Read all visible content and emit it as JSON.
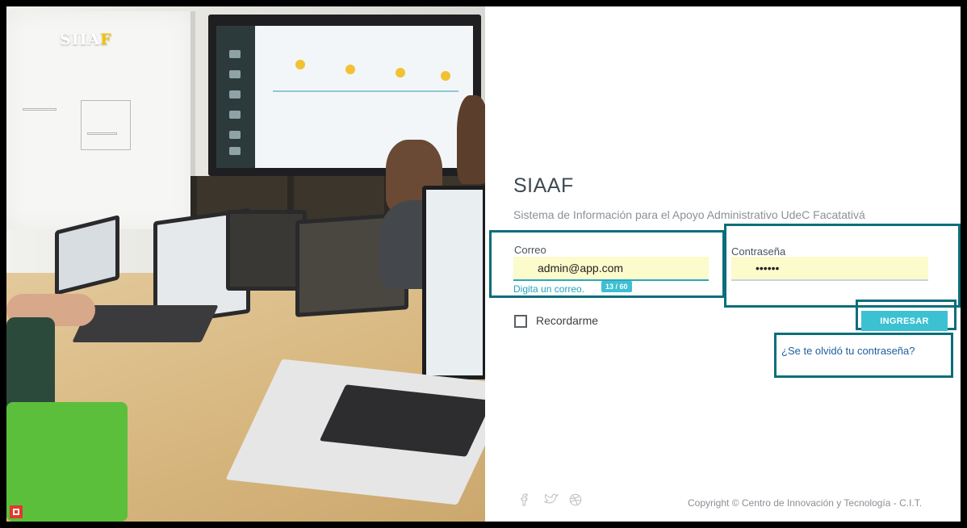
{
  "brand": {
    "logo_main": "SIIA",
    "logo_accent": "F"
  },
  "login": {
    "title": "SIAAF",
    "subtitle": "Sistema de Información para el Apoyo Administrativo UdeC Facatativá",
    "email": {
      "label": "Correo",
      "value": "admin@app.com",
      "helper": "Digita un correo.",
      "counter": "13 / 60",
      "icon": "envelope-icon"
    },
    "password": {
      "label": "Contraseña",
      "value": "123456",
      "icon": "key-icon"
    },
    "remember_label": "Recordarme",
    "submit_label": "INGRESAR",
    "forgot_label": "¿Se te olvidó tu contraseña?"
  },
  "footer": {
    "social_icons": [
      "facebook-icon",
      "twitter-icon",
      "dribbble-icon"
    ],
    "copyright": "Copyright © Centro de Innovación y Tecnología - C.I.T."
  },
  "colors": {
    "accent": "#3cc1d3",
    "highlight_box": "#0b6e7a",
    "input_bg": "#fbfbcc",
    "logo_accent": "#f2c200"
  }
}
